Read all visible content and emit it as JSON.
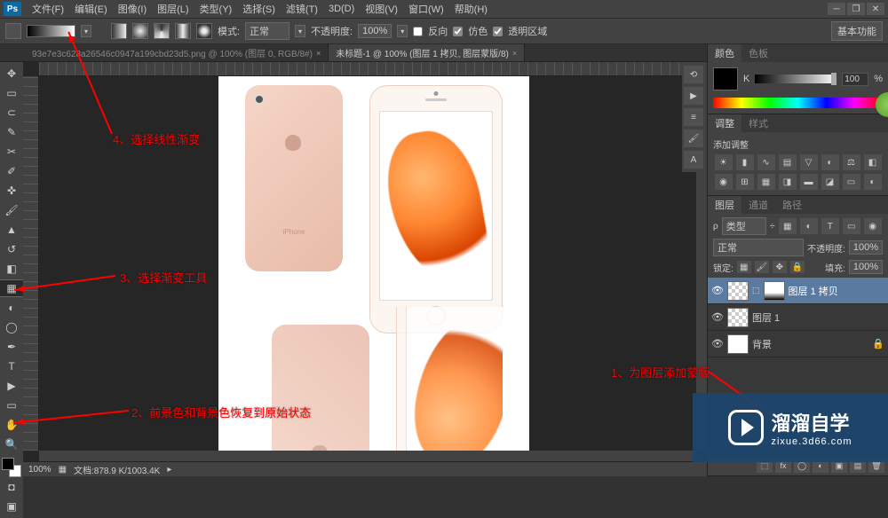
{
  "menubar": {
    "items": [
      "文件(F)",
      "编辑(E)",
      "图像(I)",
      "图层(L)",
      "类型(Y)",
      "选择(S)",
      "滤镜(T)",
      "3D(D)",
      "视图(V)",
      "窗口(W)",
      "帮助(H)"
    ]
  },
  "optbar": {
    "mode_label": "模式:",
    "mode_value": "正常",
    "opacity_label": "不透明度:",
    "opacity_value": "100%",
    "reverse": "反向",
    "dither": "仿色",
    "transparency": "透明区域",
    "basic_fn": "基本功能"
  },
  "doctabs": {
    "tab1": "93e7e3c628a26546c0947a199cbd23d5.png @ 100% (图层 0, RGB/8#)",
    "tab2": "未标题-1 @ 100% (图层 1 拷贝, 图层蒙版/8)"
  },
  "statusbar": {
    "zoom": "100%",
    "docinfo": "文档:878.9 K/1003.4K"
  },
  "panels": {
    "color_tab": "颜色",
    "swatch_tab": "色板",
    "k_label": "K",
    "k_value": "100",
    "pct": "%",
    "adjust_tab": "调整",
    "style_tab": "样式",
    "add_adjust": "添加调整",
    "layers_tab": "图层",
    "channels_tab": "通道",
    "paths_tab": "路径",
    "kind_label": "类型",
    "blend_value": "正常",
    "opacity_lbl": "不透明度:",
    "opacity_val": "100%",
    "lock_label": "锁定:",
    "fill_label": "填充:",
    "fill_val": "100%",
    "layer1": "图层 1 拷贝",
    "layer2": "图层 1",
    "layer3": "背景"
  },
  "annotations": {
    "a1": "1、为图层添加蒙版",
    "a2": "2、前景色和背景色恢复到原始状态",
    "a3": "3、选择渐变工具",
    "a4": "4、选择线性渐变"
  },
  "watermark": {
    "big": "溜溜自学",
    "small": "zixue.3d66.com"
  },
  "phone": {
    "brand": "iPhone"
  }
}
